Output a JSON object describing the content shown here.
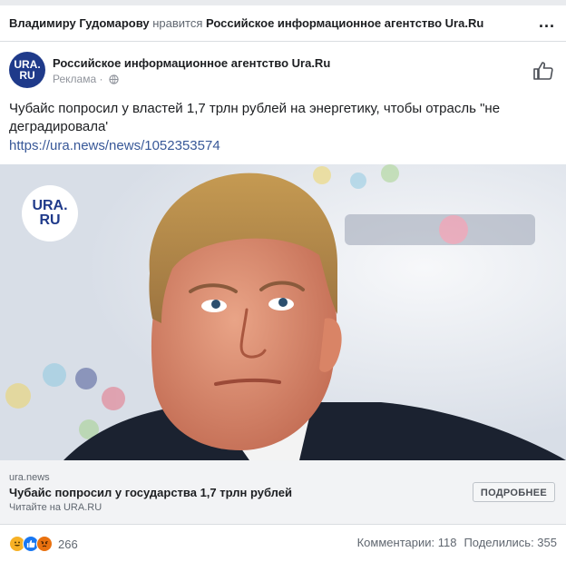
{
  "header": {
    "actor_name": "Владимиру Гудомарову",
    "verb": "нравится",
    "page_name": "Российское информационное агентство Ura.Ru",
    "more_icon": "more-horizontal-icon",
    "more_label": "..."
  },
  "post": {
    "avatar_text": "URA.RU",
    "page_name": "Российское информационное агентство Ura.Ru",
    "sponsored_label": "Реклама ·",
    "privacy_icon": "globe-icon",
    "like_icon": "thumbs-up-icon",
    "text": "Чубайс попросил у властей 1,7 трлн рублей на энергетику, чтобы отрасль \"не деградировала'",
    "link": "https://ura.news/news/1052353574"
  },
  "image": {
    "badge_text": "URA.RU",
    "alt": "photo"
  },
  "link_preview": {
    "domain": "ura.news",
    "title": "Чубайс попросил у государства 1,7 трлн рублей",
    "caption": "Читайте на URA.RU",
    "cta_label": "ПОДРОБНЕЕ"
  },
  "footer": {
    "reaction_icons": [
      "haha-reaction-icon",
      "like-reaction-icon",
      "angry-reaction-icon"
    ],
    "reaction_count": "266",
    "comments_label": "Комментарии: 118",
    "shares_label": "Поделились: 355"
  },
  "colors": {
    "brand_blue": "#1f3a8a",
    "link_blue": "#385898",
    "divider": "#dadde1",
    "link_box_bg": "#f2f3f5"
  }
}
